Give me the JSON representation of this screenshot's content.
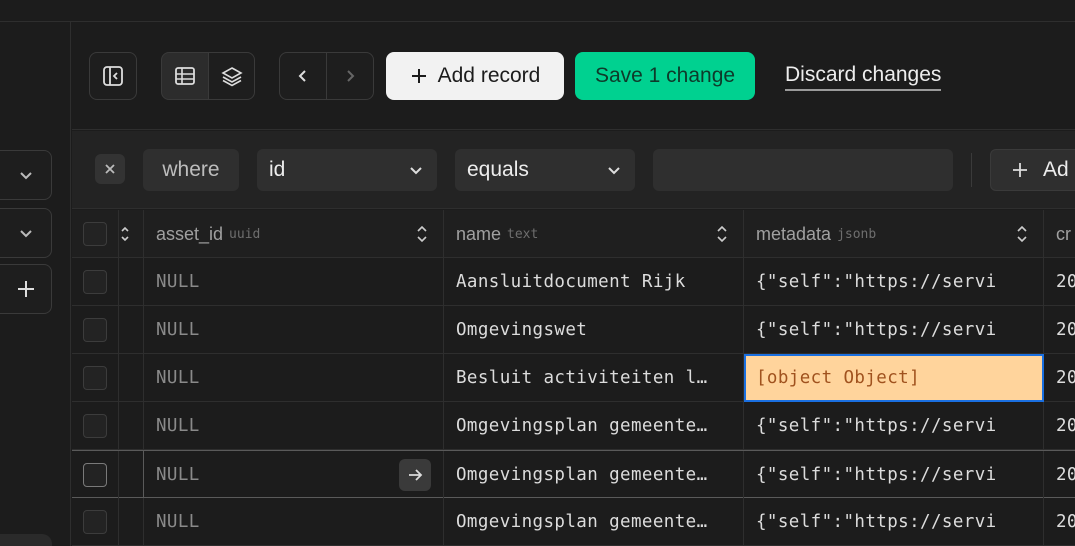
{
  "toolbar": {
    "add_record_label": "Add record",
    "save_label": "Save 1 change",
    "discard_label": "Discard changes"
  },
  "filter": {
    "where_label": "where",
    "column_value": "id",
    "operator_value": "equals",
    "filter_value": "",
    "add_label": "Ad"
  },
  "columns": [
    {
      "name": "asset_id",
      "type": "uuid"
    },
    {
      "name": "name",
      "type": "text"
    },
    {
      "name": "metadata",
      "type": "jsonb"
    },
    {
      "name": "cr",
      "type": ""
    }
  ],
  "rows": [
    {
      "asset_id": "NULL",
      "name": "Aansluitdocument Rijk",
      "metadata": "{\"self\":\"https://servi",
      "created": "20"
    },
    {
      "asset_id": "NULL",
      "name": "Omgevingswet",
      "metadata": "{\"self\":\"https://servi",
      "created": "20"
    },
    {
      "asset_id": "NULL",
      "name": "Besluit activiteiten l…",
      "metadata": "[object Object]",
      "created": "20"
    },
    {
      "asset_id": "NULL",
      "name": "Omgevingsplan gemeente…",
      "metadata": "{\"self\":\"https://servi",
      "created": "20"
    },
    {
      "asset_id": "NULL",
      "name": "Omgevingsplan gemeente…",
      "metadata": "{\"self\":\"https://servi",
      "created": "20"
    },
    {
      "asset_id": "NULL",
      "name": "Omgevingsplan gemeente…",
      "metadata": "{\"self\":\"https://servi",
      "created": "20"
    }
  ],
  "colors": {
    "save_button": "#00d190",
    "selected_cell": "#ffd49c",
    "selected_outline": "#1a6fe0"
  }
}
